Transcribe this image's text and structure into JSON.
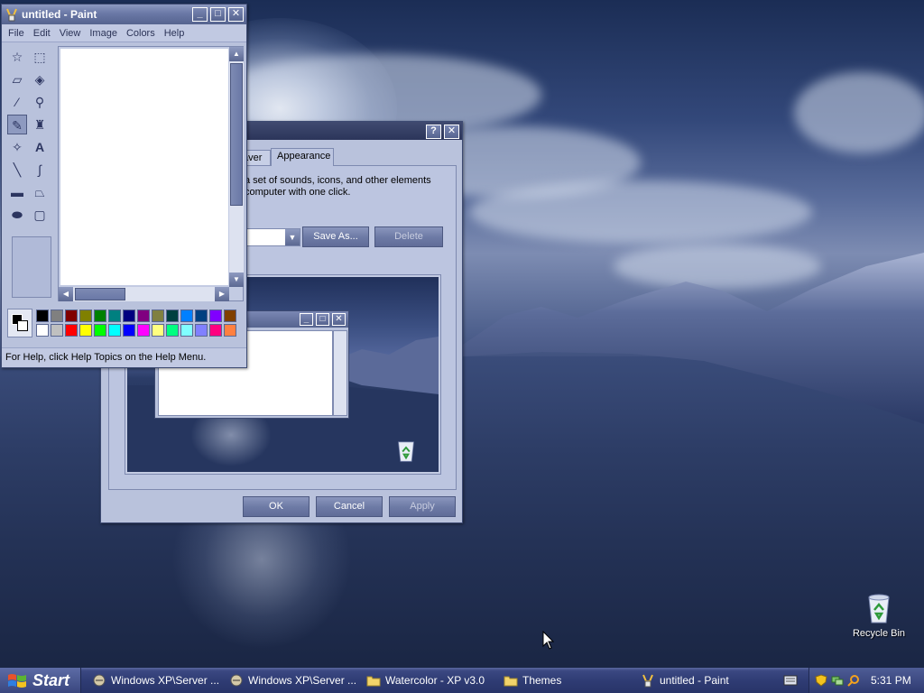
{
  "desktop": {
    "recycle_bin_label": "Recycle Bin"
  },
  "paint": {
    "title": "untitled - Paint",
    "menu": [
      "File",
      "Edit",
      "View",
      "Image",
      "Colors",
      "Help"
    ],
    "status": "For Help, click Help Topics on the Help Menu.",
    "palette_row1": [
      "#000000",
      "#808080",
      "#800000",
      "#808000",
      "#008000",
      "#008080",
      "#000080",
      "#800080",
      "#808040",
      "#004040",
      "#0080ff",
      "#004080",
      "#8000ff",
      "#804000"
    ],
    "palette_row2": [
      "#ffffff",
      "#c0c0c0",
      "#ff0000",
      "#ffff00",
      "#00ff00",
      "#00ffff",
      "#0000ff",
      "#ff00ff",
      "#ffff80",
      "#00ff80",
      "#80ffff",
      "#8080ff",
      "#ff0080",
      "#ff8040"
    ],
    "foreground_color": "#000000",
    "background_color": "#ffffff"
  },
  "dialog": {
    "tabs": [
      "aver",
      "Appearance"
    ],
    "description": "a set of sounds, icons, and other elements\ncomputer with one click.",
    "save_as": "Save As...",
    "delete": "Delete",
    "ok": "OK",
    "cancel": "Cancel",
    "apply": "Apply",
    "help_glyph": "?",
    "close_glyph": "✕"
  },
  "taskbar": {
    "start": "Start",
    "tasks": [
      "Windows XP\\Server ...",
      "Windows XP\\Server ...",
      "Watercolor - XP v3.0",
      "Themes",
      "untitled - Paint"
    ],
    "clock": "5:31 PM"
  },
  "colors": {
    "title_gradient_top": "#8d99c0",
    "window_face": "#b9c2dc",
    "taskbar": "#2f3c74"
  }
}
